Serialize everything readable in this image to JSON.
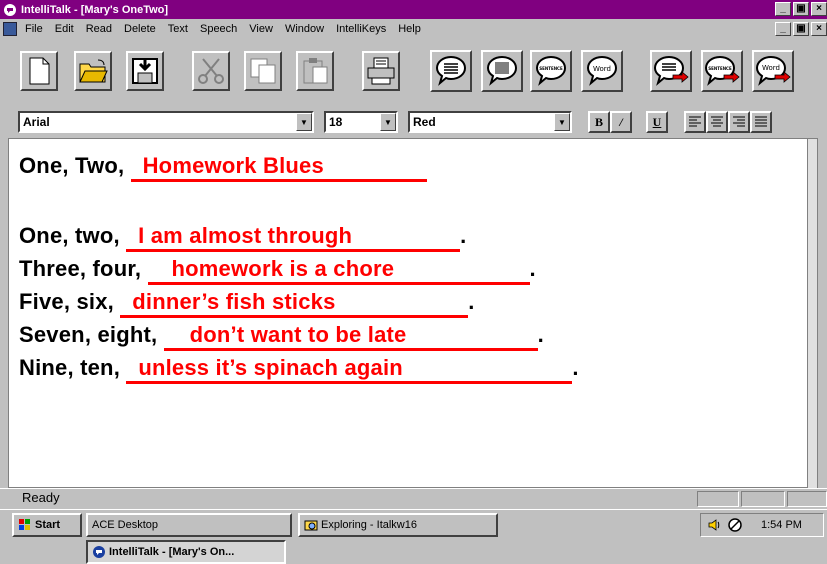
{
  "window": {
    "title": "IntelliTalk - [Mary's OneTwo]",
    "buttons": [
      "_",
      "Ѱ",
      "×"
    ]
  },
  "menubar": {
    "items": [
      {
        "label": "File",
        "key": "F"
      },
      {
        "label": "Edit",
        "key": "E"
      },
      {
        "label": "Read",
        "key": "R"
      },
      {
        "label": "Delete",
        "key": "D"
      },
      {
        "label": "Text",
        "key": "T"
      },
      {
        "label": "Speech",
        "key": "S"
      },
      {
        "label": "View",
        "key": "V"
      },
      {
        "label": "Window",
        "key": "W"
      },
      {
        "label": "IntelliKeys",
        "key": "I"
      },
      {
        "label": "Help",
        "key": "H"
      }
    ]
  },
  "toolbar": {
    "speech_word_label": "Word",
    "speech_sentence_label": "SENTENCE"
  },
  "formatbar": {
    "font": "Arial",
    "size": "18",
    "color": "Red",
    "bold": "B",
    "italic": "/",
    "underline": "U"
  },
  "document": {
    "lines": [
      {
        "prefix": "One, Two, ",
        "answer": "Homework Blues",
        "suffix": ""
      },
      {
        "prefix": "One, two, ",
        "answer": "I am almost through",
        "suffix": "."
      },
      {
        "prefix": "Three, four, ",
        "answer": "homework is a chore",
        "suffix": "."
      },
      {
        "prefix": "Five, six, ",
        "answer": "dinner’s fish sticks",
        "suffix": "."
      },
      {
        "prefix": "Seven, eight, ",
        "answer": "don’t want to be late",
        "suffix": "."
      },
      {
        "prefix": "Nine, ten, ",
        "answer": "unless it’s spinach again",
        "suffix": "."
      }
    ],
    "answer_color": "#ff0000"
  },
  "statusbar": {
    "text": "Ready"
  },
  "taskbar": {
    "start_label": "Start",
    "tasks": [
      {
        "label": "ACE Desktop"
      },
      {
        "label": "Exploring - Italkw16"
      },
      {
        "label": "IntelliTalk - [Mary's On..."
      }
    ],
    "clock": "1:54 PM"
  },
  "colors": {
    "titlebar": "#800080",
    "chrome": "#c0c0c0",
    "accent_red": "#ff0000"
  }
}
